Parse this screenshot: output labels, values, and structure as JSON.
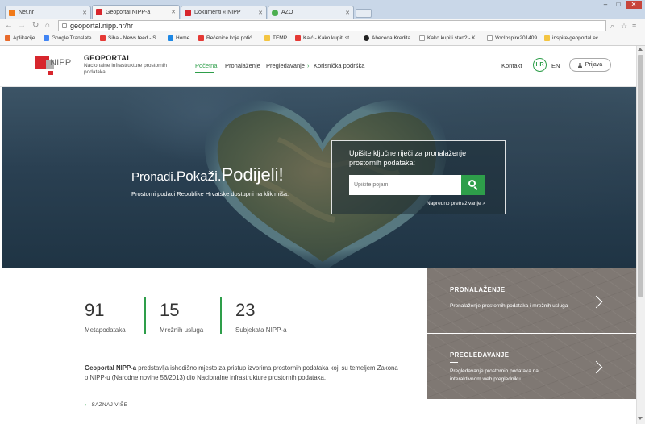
{
  "browser": {
    "tabs": [
      {
        "title": "Net.hr",
        "favicon_color": "#f07a1a"
      },
      {
        "title": "Geoportal NIPP-a",
        "favicon_color": "#d7262d"
      },
      {
        "title": "Dokumenti « NIPP",
        "favicon_color": "#d7262d"
      },
      {
        "title": "AZO",
        "favicon_color": "#4caf50"
      }
    ],
    "url": "geoportal.nipp.hr/hr",
    "bookmarks": [
      {
        "label": "Aplikacije",
        "icon_color": "#e86a2b"
      },
      {
        "label": "Google Translate",
        "icon_color": "#4285f4"
      },
      {
        "label": "Siba - News feed - S...",
        "icon_color": "#e53935"
      },
      {
        "label": "Home",
        "icon_color": "#1e88e5"
      },
      {
        "label": "Rečenice koje potić...",
        "icon_color": "#e53935"
      },
      {
        "label": "TEMP",
        "icon_color": "#f4c542"
      },
      {
        "label": "Kaić - Kako kupiti st...",
        "icon_color": "#e53935"
      },
      {
        "label": "Abeceda Kredita",
        "icon_color": "#222222"
      },
      {
        "label": "Kako kupiti stan? - K...",
        "icon_color": "#9e9e9e"
      },
      {
        "label": "VocInspire201409",
        "icon_color": "#9e9e9e"
      },
      {
        "label": "inspire-geoportal.ec...",
        "icon_color": "#f4c542"
      }
    ]
  },
  "site": {
    "logo_text": "NIPP",
    "brand": "GEOPORTAL",
    "brand_sub": "Nacionalne infrastrukture prostornih podataka",
    "nav": [
      "Početna",
      "Pronalaženje",
      "Pregledavanje",
      "Korisnička podrška"
    ],
    "contact": "Kontakt",
    "lang_hr": "HR",
    "lang_en": "EN",
    "login": "Prijava"
  },
  "hero": {
    "title_1": "Pronađi.",
    "title_2": "Pokaži.",
    "title_3": "Podijeli!",
    "subtitle": "Prostorni podaci Republike Hrvatske dostupni na klik miša.",
    "search_label": "Upišite ključne riječi za pronalaženje prostornih podataka:",
    "search_placeholder": "Upišite pojam",
    "advanced_search": "Napredno pretraživanje >"
  },
  "stats": [
    {
      "value": "91",
      "label": "Metapodataka"
    },
    {
      "value": "15",
      "label": "Mrežnih usluga"
    },
    {
      "value": "23",
      "label": "Subjekata NIPP-a"
    }
  ],
  "about": {
    "bold": "Geoportal NIPP-a",
    "text": " predstavlja ishodišno mjesto za pristup izvorima prostornih podataka koji su temeljem Zakona o NIPP-u (Narodne novine 56/2013) dio Nacionalne infrastrukture prostornih podataka.",
    "more": "SAZNAJ VIŠE"
  },
  "panels": [
    {
      "title": "PRONALAŽENJE",
      "desc": "Pronalaženje prostornih podataka i mrežnih usluga"
    },
    {
      "title": "PREGLEDAVANJE",
      "desc": "Pregledavanje prostornih podataka na interaktivnom web pregledniku"
    }
  ],
  "colors": {
    "accent": "#2e9e4a",
    "brand_red": "#d7262d",
    "panel_bg": "#7f7873"
  }
}
